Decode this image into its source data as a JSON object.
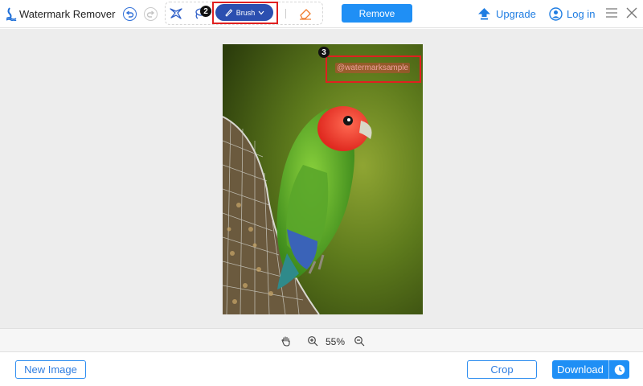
{
  "app": {
    "title": "Watermark Remover"
  },
  "toolbar": {
    "brush_label": "Brush",
    "remove_label": "Remove",
    "step_badge_2": "2",
    "step_badge_3": "3",
    "upgrade_label": "Upgrade",
    "login_label": "Log in"
  },
  "image": {
    "watermark_text": "@watermarksample"
  },
  "zoom": {
    "value": "55%"
  },
  "footer": {
    "new_image_label": "New Image",
    "crop_label": "Crop",
    "download_label": "Download"
  },
  "colors": {
    "accent": "#1f8ff5",
    "brush_button": "#2b4fb0",
    "highlight_red": "#e02020",
    "canvas_bg": "#ededed"
  },
  "icons": [
    "logo-icon",
    "undo-icon",
    "redo-icon",
    "magic-lasso-icon",
    "lasso-icon",
    "brush-icon",
    "chevron-down-icon",
    "eraser-icon",
    "upgrade-arrow-icon",
    "user-icon",
    "menu-icon",
    "close-icon",
    "hand-icon",
    "zoom-in-icon",
    "zoom-out-icon",
    "clock-icon"
  ]
}
